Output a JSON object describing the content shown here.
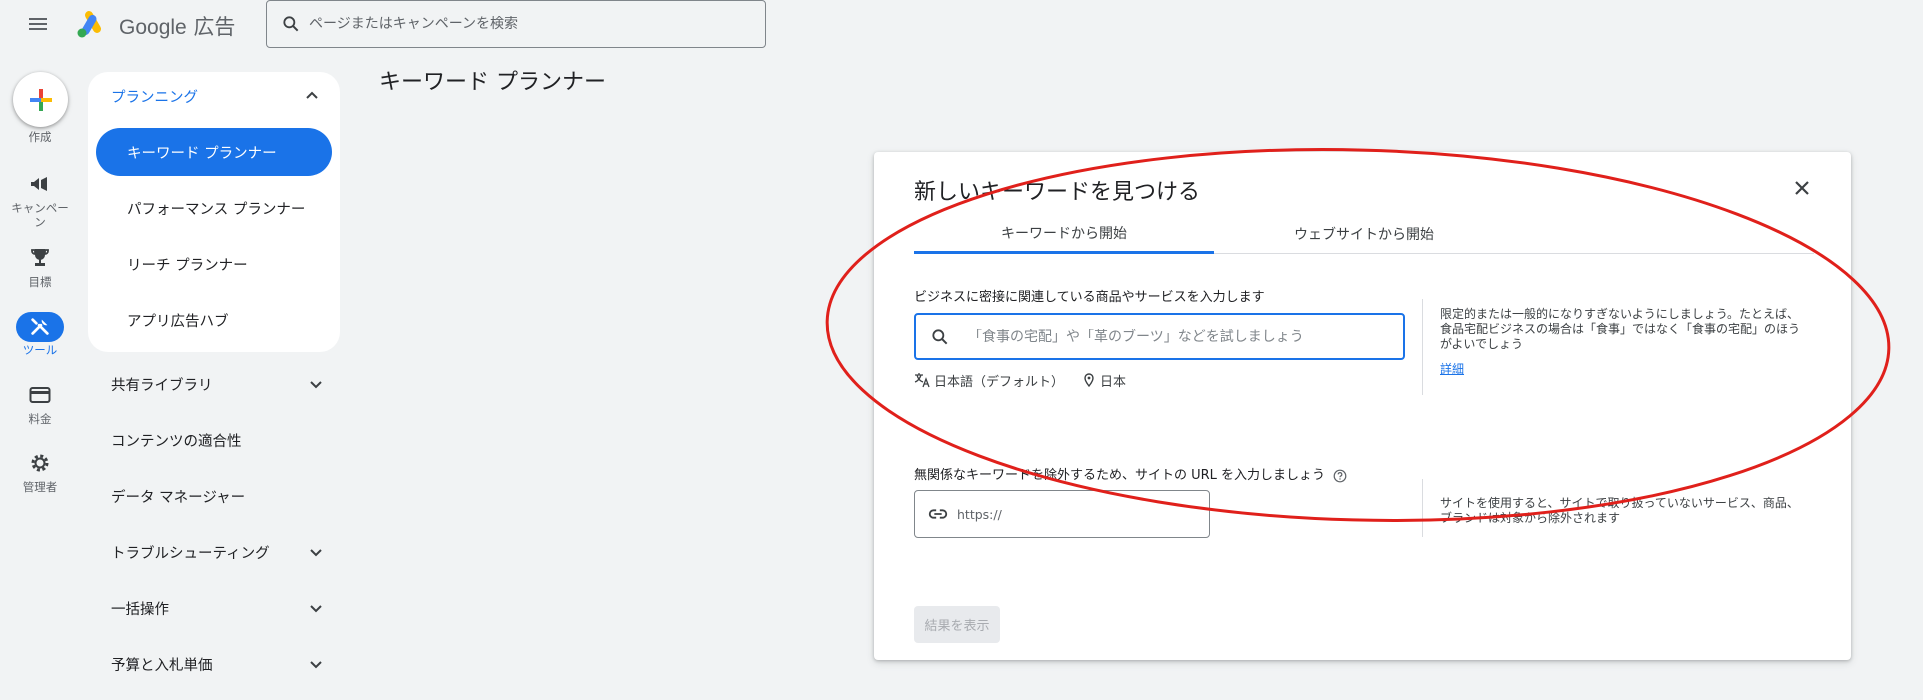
{
  "topbar": {
    "brand_google": "Google",
    "brand_ads": "広告",
    "search_placeholder": "ページまたはキャンペーンを検索"
  },
  "rail": {
    "create_label": "作成",
    "campaigns_label_line1": "キャンペー",
    "campaigns_label_line2": "ン",
    "goals_label": "目標",
    "tools_label": "ツール",
    "billing_label": "料金",
    "admin_label": "管理者"
  },
  "nav": {
    "section_title": "プランニング",
    "sub_items": [
      "キーワード プランナー",
      "パフォーマンス プランナー",
      "リーチ プランナー",
      "アプリ広告ハブ"
    ],
    "items": [
      "共有ライブラリ",
      "コンテンツの適合性",
      "データ マネージャー",
      "トラブルシューティング",
      "一括操作",
      "予算と入札単価"
    ]
  },
  "page": {
    "title": "キーワード プランナー"
  },
  "dialog": {
    "title": "新しいキーワードを見つける",
    "tabs": [
      "キーワードから開始",
      "ウェブサイトから開始"
    ],
    "keyword_label": "ビジネスに密接に関連している商品やサービスを入力します",
    "keyword_placeholder": "「食事の宅配」や「革のブーツ」などを試しましょう",
    "language": "日本語（デフォルト）",
    "location": "日本",
    "keyword_hint": "限定的または一般的になりすぎないようにしましょう。たとえば、食品宅配ビジネスの場合は「食事」ではなく「食事の宅配」のほうがよいでしょう",
    "keyword_hint_link": "詳細",
    "url_label": "無関係なキーワードを除外するため、サイトの URL を入力しましょう",
    "url_placeholder": "https://",
    "url_hint": "サイトを使用すると、サイトで取り扱っていないサービス、商品、ブランドは対象から除外されます",
    "results_button": "結果を表示"
  },
  "colors": {
    "accent": "#1a73e8",
    "annotation": "#e0201b"
  }
}
